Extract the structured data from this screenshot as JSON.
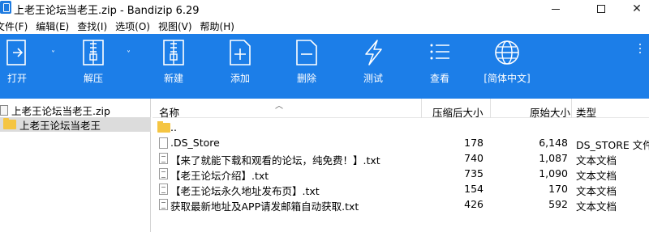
{
  "window": {
    "title": "上老王论坛当老王.zip - Bandizip 6.29",
    "min_glyph": "",
    "max_glyph": "",
    "close_glyph": "✕"
  },
  "menu": {
    "items": [
      "文件(F)",
      "编辑(E)",
      "查找(I)",
      "选项(O)",
      "视图(V)",
      "帮助(H)"
    ]
  },
  "toolbar": {
    "open": "打开",
    "extract": "解压",
    "new": "新建",
    "add": "添加",
    "delete": "删除",
    "test": "测试",
    "view": "查看",
    "language": "[简体中文]",
    "dropdown_glyph": "˅"
  },
  "tree": {
    "root": "上老王论坛当老王.zip",
    "child": "上老王论坛当老王"
  },
  "columns": {
    "name": "名称",
    "packed": "压缩后大小",
    "size": "原始大小",
    "type": "类型"
  },
  "files": [
    {
      "name": "..",
      "packed": "",
      "size": "",
      "type": ""
    },
    {
      "name": ".DS_Store",
      "packed": "178",
      "size": "6,148",
      "type": "DS_STORE 文件"
    },
    {
      "name": "【来了就能下载和观看的论坛，纯免费！】.txt",
      "packed": "740",
      "size": "1,087",
      "type": "文本文档"
    },
    {
      "name": "【老王论坛介绍】.txt",
      "packed": "735",
      "size": "1,090",
      "type": "文本文档"
    },
    {
      "name": "【老王论坛永久地址发布页】.txt",
      "packed": "154",
      "size": "170",
      "type": "文本文档"
    },
    {
      "name": "获取最新地址及APP请发邮箱自动获取.txt",
      "packed": "426",
      "size": "592",
      "type": "文本文档"
    }
  ],
  "colors": {
    "toolbar_bg": "#1c7ee8",
    "selection_bg": "#dcdcdc",
    "folder": "#f5c542"
  }
}
